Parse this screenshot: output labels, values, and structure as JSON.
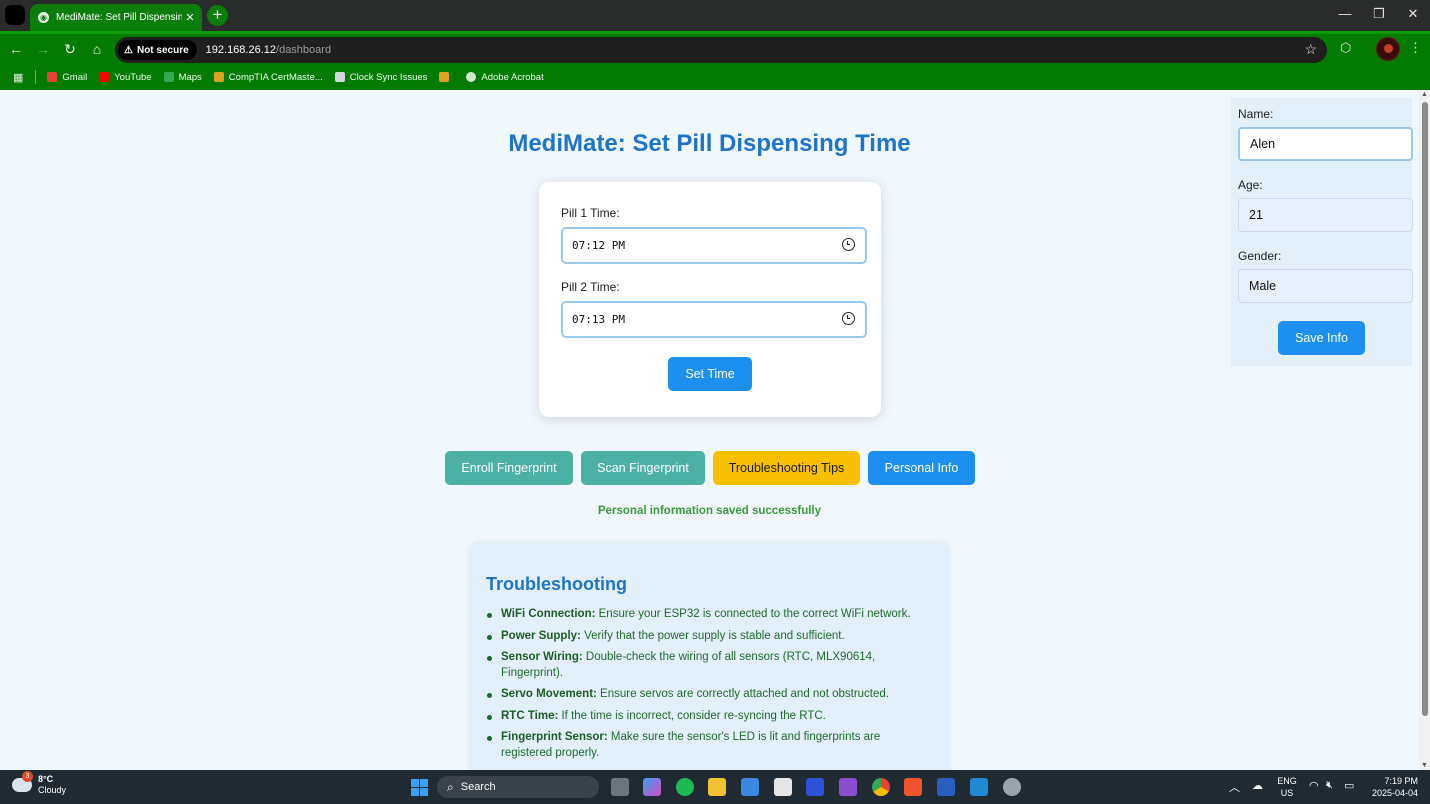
{
  "browser": {
    "tab_title": "MediMate: Set Pill Dispensing",
    "tab_close": "✕",
    "new_tab": "+",
    "minimize": "—",
    "restore": "❐",
    "close": "✕",
    "security_label": "Not secure",
    "url_host": "192.168.26.12",
    "url_path": "/dashboard",
    "bookmarks": [
      {
        "label": "Gmail",
        "color": "#ea4335"
      },
      {
        "label": "YouTube",
        "color": "#ff0000"
      },
      {
        "label": "Maps",
        "color": "#34a853"
      },
      {
        "label": "CompTIA CertMaste...",
        "color": "#e0a020"
      },
      {
        "label": "Clock Sync Issues",
        "color": "#cfd8dc"
      },
      {
        "label": "",
        "color": "#e0a020"
      },
      {
        "label": "Adobe Acrobat",
        "color": "#cfe8cf"
      }
    ]
  },
  "page": {
    "title": "MediMate: Set Pill Dispensing Time",
    "pill1_label": "Pill 1 Time:",
    "pill1_value": "07:12  PM",
    "pill2_label": "Pill 2 Time:",
    "pill2_value": "07:13  PM",
    "set_time_button": "Set Time",
    "actions": {
      "enroll": "Enroll Fingerprint",
      "scan": "Scan Fingerprint",
      "troubleshooting": "Troubleshooting Tips",
      "personal": "Personal Info"
    },
    "status_message": "Personal information saved successfully",
    "troubleshooting": {
      "title": "Troubleshooting",
      "items": [
        {
          "term": "WiFi Connection:",
          "text": " Ensure your ESP32 is connected to the correct WiFi network."
        },
        {
          "term": "Power Supply:",
          "text": " Verify that the power supply is stable and sufficient."
        },
        {
          "term": "Sensor Wiring:",
          "text": " Double-check the wiring of all sensors (RTC, MLX90614, Fingerprint)."
        },
        {
          "term": "Servo Movement:",
          "text": " Ensure servos are correctly attached and not obstructed."
        },
        {
          "term": "RTC Time:",
          "text": " If the time is incorrect, consider re-syncing the RTC."
        },
        {
          "term": "Fingerprint Sensor:",
          "text": " Make sure the sensor's LED is lit and fingerprints are registered properly."
        }
      ]
    }
  },
  "sidebar": {
    "name_label": "Name:",
    "name_value": "Alen",
    "age_label": "Age:",
    "age_value": "21",
    "gender_label": "Gender:",
    "gender_value": "Male",
    "save_button": "Save Info"
  },
  "taskbar": {
    "temperature": "8°C",
    "condition": "Cloudy",
    "weather_badge": "3",
    "search_label": "Search",
    "lang_line1": "ENG",
    "lang_line2": "US",
    "time": "7:19 PM",
    "date": "2025-04-04"
  },
  "colors": {
    "accent": "#1d8fef",
    "title": "#1f74c6",
    "teal": "#4cb0a5",
    "yellow": "#f9c002",
    "success": "#3a9a3a",
    "browser_green": "#037b03"
  }
}
